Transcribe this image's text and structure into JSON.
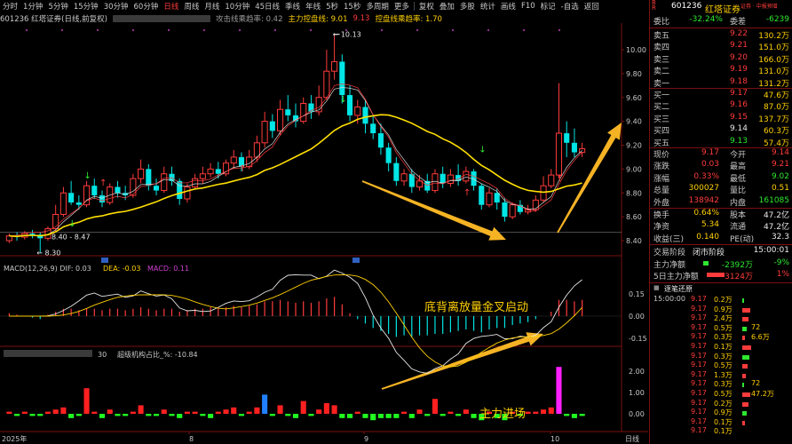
{
  "toolbar": {
    "tabs": [
      "分时",
      "1分钟",
      "5分钟",
      "15分钟",
      "30分钟",
      "60分钟",
      "日线",
      "周线",
      "月线",
      "10分钟",
      "45日线",
      "季线",
      "年线",
      "5秒",
      "15秒",
      "多周期",
      "更多"
    ],
    "active": "日线",
    "tools": [
      "复权",
      "叠加",
      "多股",
      "统计",
      "画线",
      "F10",
      "标记",
      "-自选",
      "返回"
    ]
  },
  "info": {
    "code_title": "601236 红塔证券(日线,前复权)",
    "ind1_label": "攻击线乘趋率: 0.42",
    "ind2_label": "主力控盘线: 9.01",
    "ind3_label": "9.13",
    "ind4_label": "控盘线乘趋率: 1.70"
  },
  "chart_data": {
    "type": "candlestick",
    "price_axis": [
      "10.00",
      "9.80",
      "9.60",
      "9.40",
      "9.20",
      "9.00",
      "8.80",
      "8.60",
      "8.40"
    ],
    "high_label": "10.13",
    "low_label": "8.30",
    "low_label2": "8.40 - 8.47",
    "x_labels": [
      "2025年",
      "8",
      "9",
      "10"
    ],
    "ref_price": "8.47",
    "macd_label": "MACD(12,26,9)  DIF: 0.03",
    "macd_dea": "DEA: -0.03",
    "macd_val": "MACD: 0.11",
    "macd_axis": [
      "0.15",
      "0.00",
      "-0.15"
    ],
    "inst_label": "超级机构占比_%: -10.84",
    "inst_prefix": "30",
    "inst_axis": [
      "2.00",
      "1.00",
      "0.00"
    ],
    "annotation_macd": "底背离放量金叉启动",
    "annotation_inst": "主力进场",
    "day_label": "日线",
    "candles": [
      [
        8.4,
        8.44,
        8.46,
        8.38
      ],
      [
        8.44,
        8.43,
        8.47,
        8.4
      ],
      [
        8.43,
        8.46,
        8.48,
        8.41
      ],
      [
        8.46,
        8.45,
        8.49,
        8.42
      ],
      [
        8.45,
        8.42,
        8.47,
        8.3
      ],
      [
        8.42,
        8.5,
        8.52,
        8.4
      ],
      [
        8.5,
        8.62,
        8.7,
        8.48
      ],
      [
        8.62,
        8.8,
        8.85,
        8.6
      ],
      [
        8.8,
        8.72,
        8.9,
        8.7
      ],
      [
        8.72,
        8.7,
        8.78,
        8.66
      ],
      [
        8.7,
        8.86,
        8.9,
        8.68
      ],
      [
        8.86,
        8.78,
        8.92,
        8.75
      ],
      [
        8.78,
        8.72,
        8.82,
        8.68
      ],
      [
        8.72,
        8.85,
        8.88,
        8.7
      ],
      [
        8.85,
        8.8,
        8.9,
        8.76
      ],
      [
        8.8,
        8.78,
        8.86,
        8.74
      ],
      [
        8.78,
        8.92,
        8.96,
        8.76
      ],
      [
        8.92,
        9.0,
        9.08,
        8.88
      ],
      [
        9.0,
        8.86,
        9.04,
        8.82
      ],
      [
        8.86,
        8.82,
        8.92,
        8.78
      ],
      [
        8.82,
        8.96,
        9.02,
        8.8
      ],
      [
        8.96,
        8.9,
        9.02,
        8.86
      ],
      [
        8.9,
        8.75,
        8.92,
        8.7
      ],
      [
        8.75,
        8.85,
        8.88,
        8.72
      ],
      [
        8.85,
        8.92,
        8.96,
        8.83
      ],
      [
        8.92,
        8.96,
        9.02,
        8.88
      ],
      [
        8.96,
        9.0,
        9.05,
        8.93
      ],
      [
        9.0,
        8.96,
        9.06,
        8.92
      ],
      [
        8.96,
        9.05,
        9.08,
        8.94
      ],
      [
        9.05,
        9.1,
        9.16,
        9.0
      ],
      [
        9.1,
        9.02,
        9.14,
        8.98
      ],
      [
        9.02,
        9.1,
        9.16,
        9.0
      ],
      [
        9.1,
        9.22,
        9.28,
        9.06
      ],
      [
        9.22,
        9.4,
        9.48,
        9.18
      ],
      [
        9.4,
        9.32,
        9.46,
        9.26
      ],
      [
        9.32,
        9.5,
        9.58,
        9.28
      ],
      [
        9.5,
        9.45,
        9.62,
        9.4
      ],
      [
        9.45,
        9.4,
        9.55,
        9.35
      ],
      [
        9.4,
        9.55,
        9.6,
        9.38
      ],
      [
        9.55,
        9.48,
        9.62,
        9.42
      ],
      [
        9.48,
        9.6,
        9.7,
        9.45
      ],
      [
        9.6,
        9.82,
        10.0,
        9.58
      ],
      [
        9.82,
        9.9,
        10.13,
        9.75
      ],
      [
        9.9,
        9.62,
        9.96,
        9.55
      ],
      [
        9.62,
        9.45,
        9.7,
        9.4
      ],
      [
        9.45,
        9.52,
        9.58,
        9.38
      ],
      [
        9.52,
        9.38,
        9.58,
        9.3
      ],
      [
        9.38,
        9.3,
        9.45,
        9.25
      ],
      [
        9.3,
        9.18,
        9.38,
        9.12
      ],
      [
        9.18,
        9.05,
        9.22,
        8.98
      ],
      [
        9.05,
        8.9,
        9.1,
        8.86
      ],
      [
        8.9,
        8.96,
        9.0,
        8.86
      ],
      [
        8.96,
        8.85,
        9.0,
        8.8
      ],
      [
        8.85,
        8.9,
        8.95,
        8.82
      ],
      [
        8.9,
        8.82,
        8.96,
        8.8
      ],
      [
        8.82,
        8.96,
        9.0,
        8.8
      ],
      [
        8.96,
        8.88,
        9.02,
        8.84
      ],
      [
        8.88,
        8.95,
        9.0,
        8.85
      ],
      [
        8.95,
        8.9,
        9.04,
        8.86
      ],
      [
        8.9,
        8.98,
        9.02,
        8.88
      ],
      [
        8.98,
        8.86,
        9.0,
        8.82
      ],
      [
        8.86,
        8.7,
        8.88,
        8.66
      ],
      [
        8.7,
        8.8,
        8.84,
        8.68
      ],
      [
        8.8,
        8.72,
        8.84,
        8.66
      ],
      [
        8.72,
        8.6,
        8.76,
        8.56
      ],
      [
        8.6,
        8.7,
        8.72,
        8.58
      ],
      [
        8.7,
        8.64,
        8.74,
        8.62
      ],
      [
        8.64,
        8.66,
        8.7,
        8.62
      ],
      [
        8.66,
        8.74,
        8.78,
        8.64
      ],
      [
        8.74,
        8.86,
        8.94,
        8.72
      ],
      [
        8.86,
        8.95,
        9.0,
        8.84
      ],
      [
        8.95,
        9.3,
        9.72,
        8.92
      ],
      [
        9.3,
        9.22,
        9.4,
        9.1
      ],
      [
        9.22,
        9.14,
        9.34,
        9.1
      ],
      [
        9.14,
        9.17,
        9.22,
        9.1
      ]
    ],
    "macd_hist": [
      0.02,
      0.01,
      0.0,
      -0.01,
      -0.02,
      0.01,
      0.03,
      0.05,
      0.05,
      0.04,
      0.05,
      0.05,
      0.04,
      0.05,
      0.05,
      0.04,
      0.05,
      0.06,
      0.05,
      0.04,
      0.05,
      0.05,
      0.03,
      0.04,
      0.05,
      0.05,
      0.06,
      0.05,
      0.06,
      0.07,
      0.06,
      0.07,
      0.08,
      0.1,
      0.1,
      0.11,
      0.1,
      0.09,
      0.1,
      0.09,
      0.1,
      0.12,
      0.13,
      0.08,
      0.02,
      -0.02,
      -0.05,
      -0.08,
      -0.1,
      -0.12,
      -0.14,
      -0.13,
      -0.14,
      -0.13,
      -0.13,
      -0.12,
      -0.12,
      -0.11,
      -0.1,
      -0.09,
      -0.1,
      -0.11,
      -0.09,
      -0.08,
      -0.08,
      -0.06,
      -0.05,
      -0.04,
      -0.02,
      0.0,
      0.03,
      0.11,
      0.11,
      0.1,
      0.11
    ],
    "inst_vals": [
      0.1,
      -0.1,
      0.1,
      -0.1,
      -0.1,
      0.1,
      0.2,
      0.3,
      -0.2,
      -0.1,
      1.2,
      0.1,
      -0.2,
      0.2,
      -0.1,
      -0.1,
      0.1,
      0.4,
      -0.1,
      -0.1,
      0.2,
      -0.1,
      -0.2,
      0.1,
      0.1,
      -0.1,
      -0.2,
      0.1,
      0.2,
      0.3,
      -0.1,
      0.1,
      0.3,
      0.9,
      -0.1,
      0.4,
      -0.1,
      -0.2,
      0.6,
      -0.1,
      0.2,
      0.5,
      0.4,
      -0.2,
      -0.2,
      0.1,
      -0.2,
      -0.3,
      -0.2,
      -0.2,
      -0.2,
      0.1,
      -0.2,
      0.2,
      -0.1,
      0.7,
      -0.1,
      0.1,
      -0.1,
      0.2,
      -0.2,
      -0.3,
      0.1,
      -0.2,
      -0.3,
      0.1,
      -0.1,
      0.1,
      0.1,
      0.2,
      0.3,
      2.2,
      -0.1,
      -0.2,
      -0.1
    ]
  },
  "panel": {
    "code": "601236",
    "name": "红塔证券",
    "tag": "证券 · 中报预增",
    "webi_label": "委比",
    "webi_val": "-32.24%",
    "wecha_label": "委差",
    "wecha_val": "-6239",
    "asks": [
      {
        "label": "卖五",
        "price": "9.22",
        "vol": "130.2万"
      },
      {
        "label": "卖四",
        "price": "9.21",
        "vol": "151.0万"
      },
      {
        "label": "卖三",
        "price": "9.20",
        "vol": "166.0万"
      },
      {
        "label": "卖二",
        "price": "9.19",
        "vol": "131.0万"
      },
      {
        "label": "卖一",
        "price": "9.18",
        "vol": "131.2万"
      }
    ],
    "bids": [
      {
        "label": "买一",
        "price": "9.17",
        "vol": "47.6万"
      },
      {
        "label": "买二",
        "price": "9.16",
        "vol": "87.0万"
      },
      {
        "label": "买三",
        "price": "9.15",
        "vol": "137.7万"
      },
      {
        "label": "买四",
        "price": "9.14",
        "vod": "",
        "vol": "60.3万"
      },
      {
        "label": "买五",
        "price": "9.13",
        "vol": "57.4万"
      }
    ],
    "stats": [
      {
        "l1": "现价",
        "v1": "9.17",
        "c1": "red",
        "l2": "今开",
        "v2": "9.14",
        "c2": "red"
      },
      {
        "l1": "涨跌",
        "v1": "0.03",
        "c1": "red",
        "l2": "最高",
        "v2": "9.21",
        "c2": "red"
      },
      {
        "l1": "涨幅",
        "v1": "0.33%",
        "c1": "red",
        "l2": "最低",
        "v2": "9.02",
        "c2": "green"
      },
      {
        "l1": "总量",
        "v1": "300027",
        "c1": "yellow",
        "l2": "量比",
        "v2": "0.51",
        "c2": "yellow"
      },
      {
        "l1": "外盘",
        "v1": "138942",
        "c1": "red",
        "l2": "内盘",
        "v2": "161085",
        "c2": "green"
      }
    ],
    "stats2": [
      {
        "l1": "换手",
        "v1": "0.64%",
        "l2": "股本",
        "v2": "47.2亿"
      },
      {
        "l1": "净资",
        "v1": "5.34",
        "l2": "流通",
        "v2": "47.2亿"
      },
      {
        "l1": "收益(三)",
        "v1": "0.140",
        "l2": "PE(动)",
        "v2": "32.3"
      }
    ],
    "trade_stage_label": "交易阶段",
    "trade_stage_val": "闭市阶段",
    "trade_time": "15:00:01",
    "main_net_label": "主力净额",
    "main_net_val": "-2392万",
    "main_net_pct": "-9%",
    "main5_label": "5日主力净额",
    "main5_val": "3124万",
    "main5_pct": "1%",
    "ticks_title": "逐笔还原",
    "ticks": [
      {
        "t": "15:00:00",
        "p": "9.17",
        "v": "0.2万",
        "x": ""
      },
      {
        "t": "",
        "p": "9.17",
        "v": "0.9万",
        "x": ""
      },
      {
        "t": "",
        "p": "9.17",
        "v": "2.4万",
        "x": ""
      },
      {
        "t": "",
        "p": "9.17",
        "v": "0.5万",
        "x": "72"
      },
      {
        "t": "",
        "p": "9.17",
        "v": "0.3万",
        "x": "6.6万"
      },
      {
        "t": "",
        "p": "9.17",
        "v": "0.1万",
        "x": ""
      },
      {
        "t": "",
        "p": "9.17",
        "v": "0.3万",
        "x": ""
      },
      {
        "t": "",
        "p": "9.17",
        "v": "0.5万",
        "x": ""
      },
      {
        "t": "",
        "p": "9.17",
        "v": "1.3万",
        "x": ""
      },
      {
        "t": "",
        "p": "9.17",
        "v": "0.3万",
        "x": "72"
      },
      {
        "t": "",
        "p": "9.17",
        "v": "0.5万",
        "x": "47.2万"
      },
      {
        "t": "",
        "p": "9.17",
        "v": "0.2万",
        "x": ""
      },
      {
        "t": "",
        "p": "9.17",
        "v": "0.9万",
        "x": ""
      },
      {
        "t": "",
        "p": "9.17",
        "v": "0.1万",
        "x": ""
      },
      {
        "t": "",
        "p": "9.17",
        "v": "0.1万",
        "x": ""
      }
    ]
  }
}
